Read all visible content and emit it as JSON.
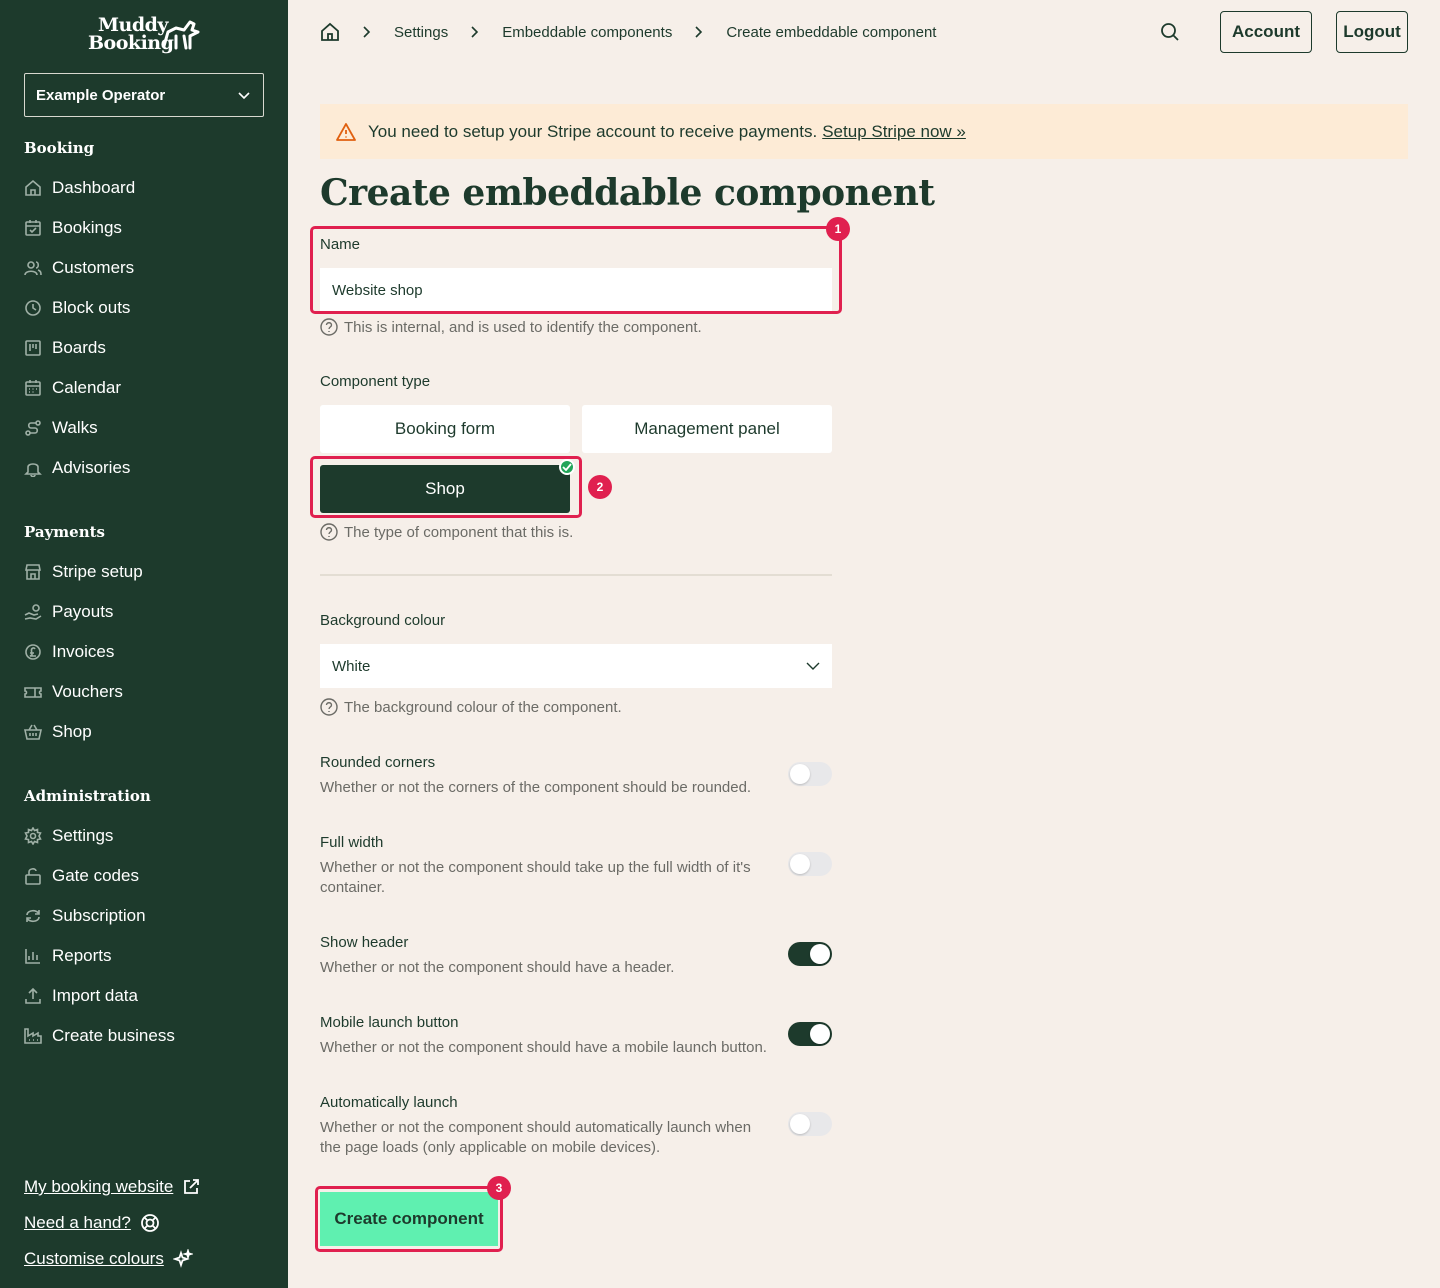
{
  "app": {
    "logo_line1": "Muddy",
    "logo_line2": "Booking",
    "operator": "Example Operator"
  },
  "sidebar": {
    "sections": [
      {
        "title": "Booking",
        "items": [
          {
            "label": "Dashboard",
            "icon": "home-icon"
          },
          {
            "label": "Bookings",
            "icon": "calendar-check-icon"
          },
          {
            "label": "Customers",
            "icon": "users-icon"
          },
          {
            "label": "Block outs",
            "icon": "clock-icon"
          },
          {
            "label": "Boards",
            "icon": "board-icon"
          },
          {
            "label": "Calendar",
            "icon": "calendar-icon"
          },
          {
            "label": "Walks",
            "icon": "route-icon"
          },
          {
            "label": "Advisories",
            "icon": "bell-icon"
          }
        ]
      },
      {
        "title": "Payments",
        "items": [
          {
            "label": "Stripe setup",
            "icon": "store-icon"
          },
          {
            "label": "Payouts",
            "icon": "hand-coins-icon"
          },
          {
            "label": "Invoices",
            "icon": "pound-icon"
          },
          {
            "label": "Vouchers",
            "icon": "ticket-icon"
          },
          {
            "label": "Shop",
            "icon": "basket-icon"
          }
        ]
      },
      {
        "title": "Administration",
        "items": [
          {
            "label": "Settings",
            "icon": "gear-icon"
          },
          {
            "label": "Gate codes",
            "icon": "lock-icon"
          },
          {
            "label": "Subscription",
            "icon": "refresh-icon"
          },
          {
            "label": "Reports",
            "icon": "chart-icon"
          },
          {
            "label": "Import data",
            "icon": "upload-icon"
          },
          {
            "label": "Create business",
            "icon": "factory-icon"
          }
        ]
      }
    ],
    "footer": {
      "website": "My booking website",
      "help": "Need a hand?",
      "colours": "Customise colours"
    }
  },
  "header": {
    "breadcrumbs": [
      "Settings",
      "Embeddable components",
      "Create embeddable component"
    ],
    "account": "Account",
    "logout": "Logout"
  },
  "alert": {
    "text": "You need to setup your Stripe account to receive payments.",
    "link": "Setup Stripe now »"
  },
  "form": {
    "title": "Create embeddable component",
    "name_label": "Name",
    "name_value": "Website shop",
    "name_help": "This is internal, and is used to identify the component.",
    "type_label": "Component type",
    "types": [
      "Booking form",
      "Management panel",
      "Shop"
    ],
    "selected_type": "Shop",
    "type_help": "The type of component that this is.",
    "bg_label": "Background colour",
    "bg_value": "White",
    "bg_help": "The background colour of the component.",
    "options": [
      {
        "title": "Rounded corners",
        "desc": "Whether or not the corners of the component should be rounded.",
        "on": false
      },
      {
        "title": "Full width",
        "desc": "Whether or not the component should take up the full width of it's container.",
        "on": false
      },
      {
        "title": "Show header",
        "desc": "Whether or not the component should have a header.",
        "on": true
      },
      {
        "title": "Mobile launch button",
        "desc": "Whether or not the component should have a mobile launch button.",
        "on": true
      },
      {
        "title": "Automatically launch",
        "desc": "Whether or not the component should automatically launch when the page loads (only applicable on mobile devices).",
        "on": false
      }
    ],
    "submit": "Create component"
  },
  "annotations": [
    "1",
    "2",
    "3"
  ],
  "colors": {
    "sidebar_bg": "#1d3a2c",
    "page_bg": "#f6efe9",
    "alert_bg": "#fdebd6",
    "accent": "#5ff0b0",
    "annotation": "#e0204f"
  }
}
